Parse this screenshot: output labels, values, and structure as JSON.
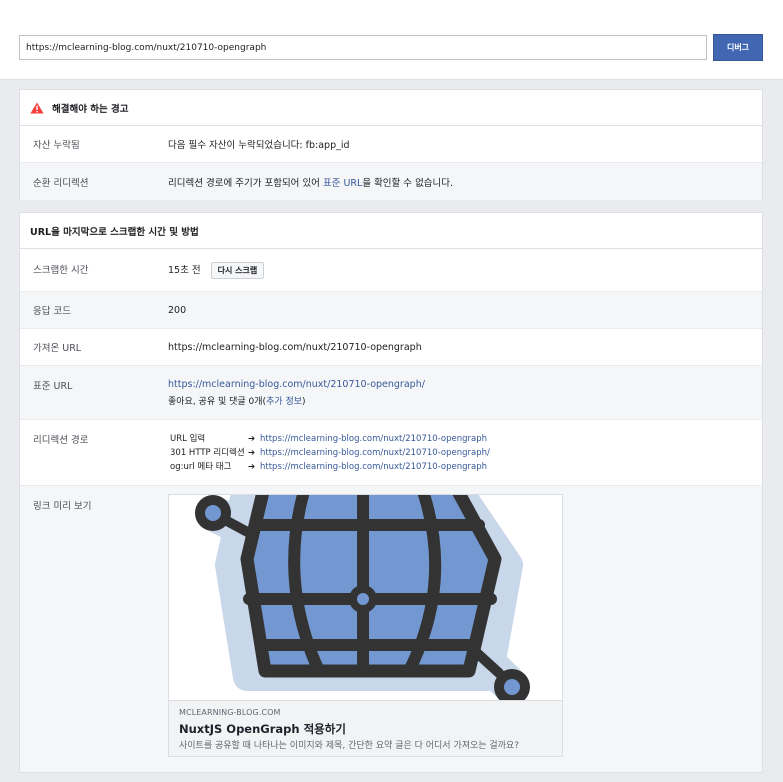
{
  "toolbar": {
    "url_value": "https://mclearning-blog.com/nuxt/210710-opengraph",
    "debug_label": "디버그"
  },
  "warnings": {
    "title": "해결해야 하는 경고",
    "rows": [
      {
        "label": "자산 누락됨",
        "value": "다음 필수 자산이 누락되었습니다: fb:app_id"
      },
      {
        "label": "순환 리디렉션",
        "before": "리디렉션 경로에 주기가 포함되어 있어 ",
        "link": "표준 URL",
        "after": "을 확인할 수 없습니다."
      }
    ]
  },
  "scrape": {
    "title": "URL을 마지막으로 스크랩한 시간 및 방법",
    "scraped_label": "스크랩한 시간",
    "scraped_value": "15초 전",
    "rescrape_label": "다시 스크랩",
    "response_label": "응답 코드",
    "response_value": "200",
    "fetched_label": "가져온 URL",
    "fetched_value": "https://mclearning-blog.com/nuxt/210710-opengraph",
    "canonical_label": "표준 URL",
    "canonical_value": "https://mclearning-blog.com/nuxt/210710-opengraph/",
    "canonical_sub_before": "좋아요, 공유 및 댓글 0개(",
    "canonical_sub_link": "추가 정보",
    "canonical_sub_after": ")",
    "redirect_label": "리디렉션 경로",
    "redirects": [
      {
        "key": "URL 입력",
        "arrow": "➔",
        "url": "https://mclearning-blog.com/nuxt/210710-opengraph"
      },
      {
        "key": "301 HTTP 리디렉션",
        "arrow": "➔",
        "url": "https://mclearning-blog.com/nuxt/210710-opengraph/"
      },
      {
        "key": "og:url 메타 태그",
        "arrow": "➔",
        "url": "https://mclearning-blog.com/nuxt/210710-opengraph"
      }
    ],
    "preview_label": "링크 미리 보기",
    "preview": {
      "domain": "MCLEARNING-BLOG.COM",
      "title": "NuxtJS OpenGraph 적용하기",
      "description": "사이트를 공유할 때 나타나는 이미지와 제목, 간단한 요약 글은 다 어디서 가져오는 걸까요?",
      "image_icon": "opengraph-logo-icon"
    }
  },
  "colors": {
    "brand_button": "#4267b2",
    "link": "#365899",
    "warning": "#fa3e3e",
    "logo_fill": "#7398d1",
    "logo_halo": "#c8d7ea",
    "logo_stroke": "#333333"
  }
}
